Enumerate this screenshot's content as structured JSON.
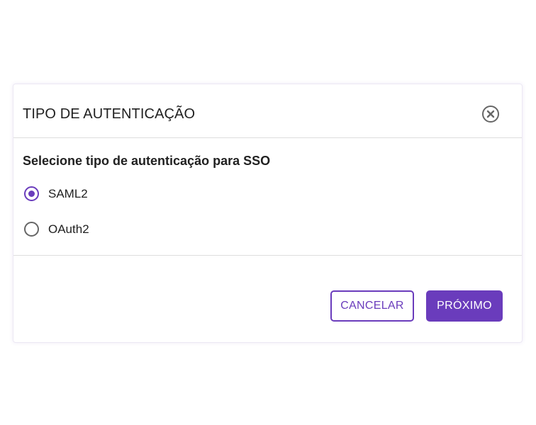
{
  "dialog": {
    "title": "TIPO DE AUTENTICAÇÃO",
    "close_icon": "close-circle-icon",
    "question": "Selecione tipo de autenticação para SSO",
    "options": [
      {
        "label": "SAML2",
        "selected": true
      },
      {
        "label": "OAuth2",
        "selected": false
      }
    ],
    "cancel_label": "CANCELAR",
    "next_label": "PRÓXIMO"
  },
  "colors": {
    "accent": "#6a3cbc",
    "text": "#212121",
    "divider": "#dddddd",
    "icon": "#666666"
  }
}
